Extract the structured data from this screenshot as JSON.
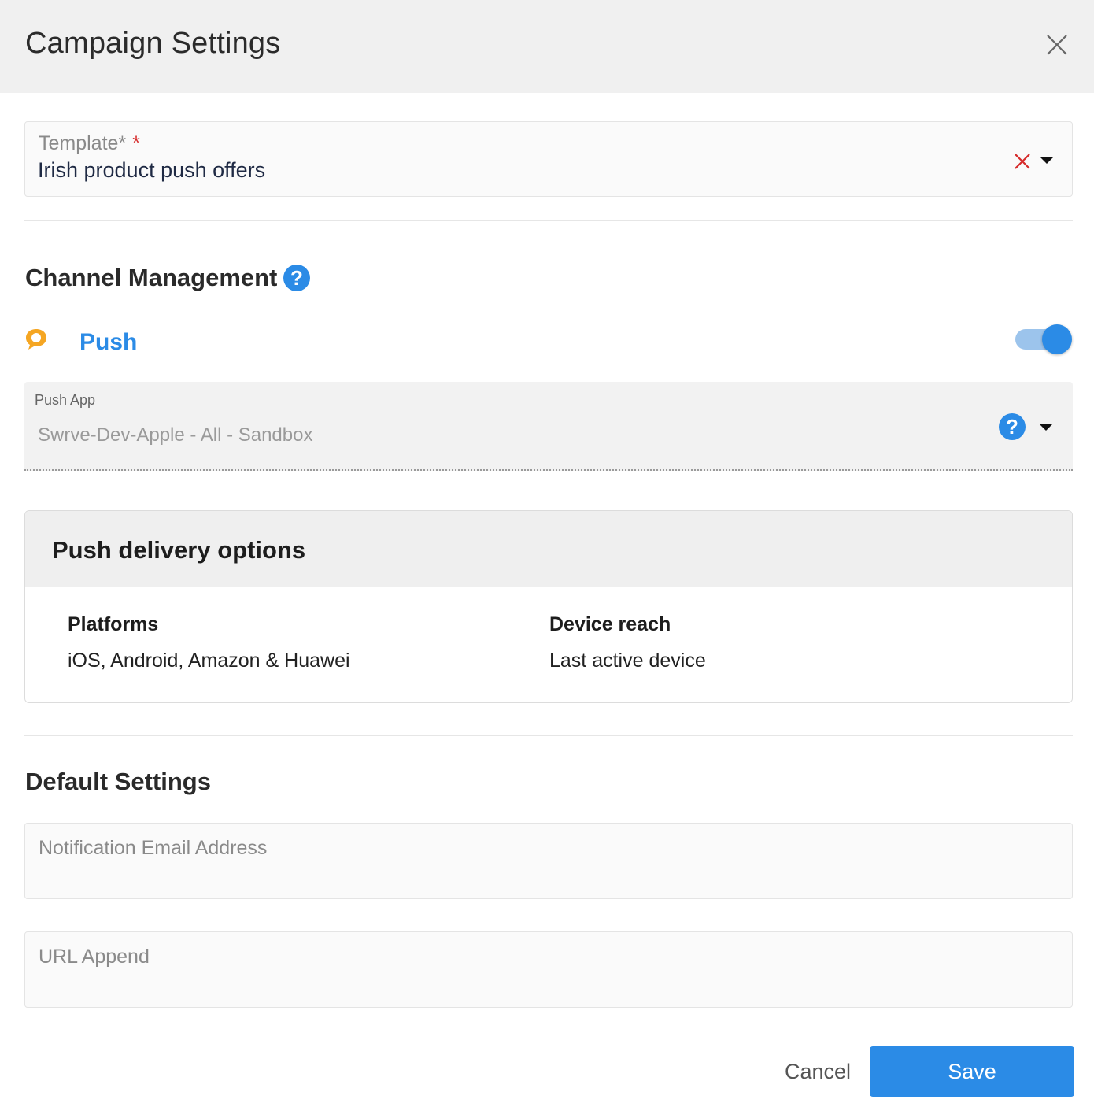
{
  "header": {
    "title": "Campaign Settings",
    "close_icon": "close-icon"
  },
  "template_field": {
    "label": "Template*",
    "required_marker": "*",
    "value": "Irish product push offers",
    "clear_icon": "clear-x-icon",
    "dropdown_icon": "caret-down-icon"
  },
  "channel_management": {
    "title": "Channel Management",
    "help_glyph": "?",
    "push": {
      "icon": "speech-bubble-icon",
      "label": "Push",
      "enabled": true
    },
    "push_app": {
      "label": "Push App",
      "value": "Swrve-Dev-Apple - All - Sandbox",
      "help_glyph": "?"
    }
  },
  "delivery_options": {
    "title": "Push delivery options",
    "platforms_label": "Platforms",
    "platforms_value": "iOS, Android, Amazon & Huawei",
    "reach_label": "Device reach",
    "reach_value": "Last active device"
  },
  "default_settings": {
    "title": "Default Settings",
    "email_placeholder": "Notification Email Address",
    "url_append_placeholder": "URL Append"
  },
  "footer": {
    "cancel_label": "Cancel",
    "save_label": "Save"
  },
  "colors": {
    "accent": "#2b8be6",
    "required": "#d62a2a",
    "push_icon": "#f5a623"
  }
}
